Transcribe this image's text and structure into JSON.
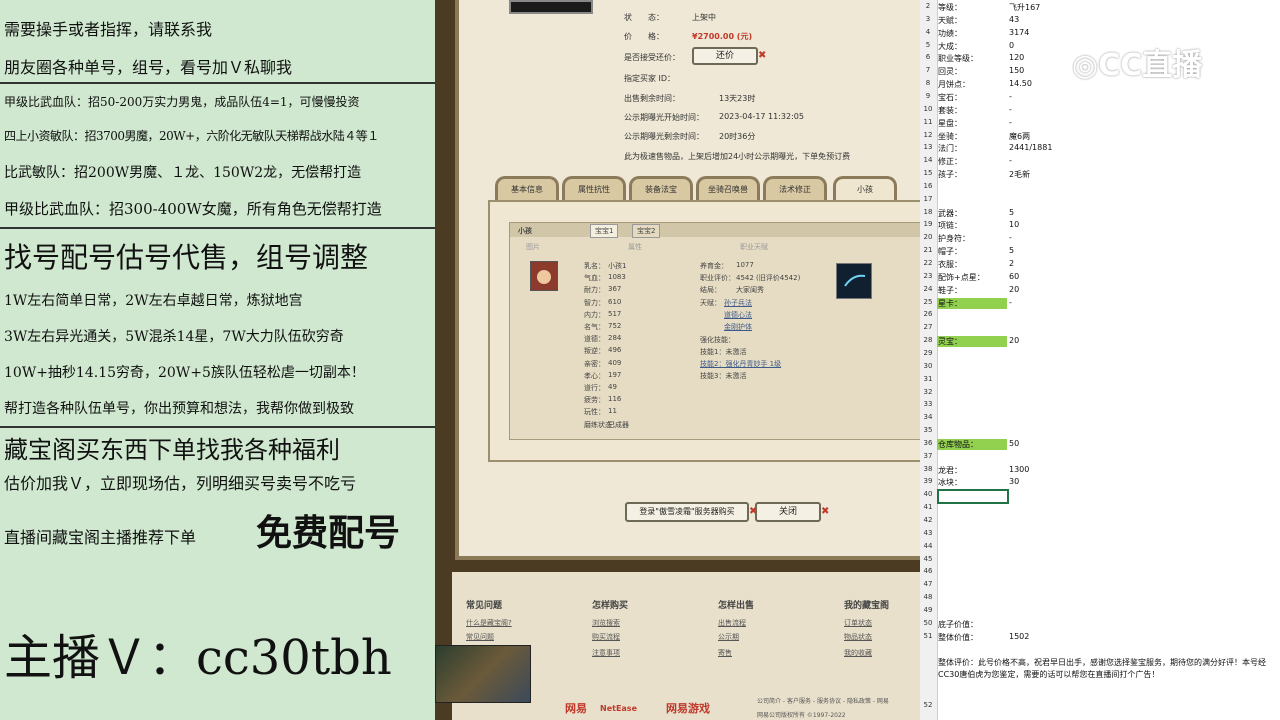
{
  "left_overlay": {
    "lines": [
      "需要操手或者指挥，请联系我",
      "朋友圈各种单号，组号，看号加Ｖ私聊我",
      "甲级比武血队：招50-200万实力男鬼，成品队伍4=1，可慢慢投资",
      "四上小资敏队：招3700男魔，20W+，六阶化无敏队天梯帮战水陆４等１",
      "比武敏队：招200W男魔、１龙、150W2龙，无偿帮打造",
      "甲级比武血队：招300-400W女魔，所有角色无偿帮打造",
      "找号配号估号代售，组号调整",
      "1W左右简单日常，2W左右卓越日常，炼狱地宫",
      "3W左右异光通关，5W混杀14星，7W大力队伍砍穷奇",
      "10W+抽秒14.15穷奇，20W+5族队伍轻松虐一切副本！",
      "帮打造各种队伍单号，你出预算和想法，我帮你做到极致",
      "藏宝阁买东西下单找我各种福利",
      "估价加我Ｖ，立即现场估，列明细买号卖号不吃亏",
      "直播间藏宝阁主播推荐下单",
      "免费配号",
      "主播Ｖ：cc30tbh"
    ]
  },
  "listing": {
    "status_label": "状　　态：",
    "status_value": "上架中",
    "price_label": "价　　格：",
    "price_value": "¥2700.00 (元)",
    "bargain_label": "是否接受还价：",
    "bargain_button": "还价",
    "buyer_id_label": "指定买家 ID：",
    "remaining_label": "出售剩余时间：",
    "remaining_value": "13天23时",
    "public_start_label": "公示期曝光开始时间：",
    "public_start_value": "2023-04-17 11:32:05",
    "public_remaining_label": "公示期曝光剩余时间：",
    "public_remaining_value": "20时36分",
    "notice": "此为极速售物品，上架后增加24小时公示期曝光，下单免预订费"
  },
  "tabs": [
    "基本信息",
    "属性抗性",
    "装备法宝",
    "坐骑召唤兽",
    "法术修正",
    "小孩"
  ],
  "child_panel": {
    "title": "小孩",
    "subtabs": [
      "宝宝1",
      "宝宝2"
    ],
    "col_headers": [
      "图片",
      "属性",
      "职业天赋"
    ],
    "stats": [
      {
        "k": "乳名：",
        "v": "小孩1"
      },
      {
        "k": "气血：",
        "v": "1083"
      },
      {
        "k": "耐力：",
        "v": "367"
      },
      {
        "k": "智力：",
        "v": "610"
      },
      {
        "k": "内力：",
        "v": "517"
      },
      {
        "k": "名气：",
        "v": "752"
      },
      {
        "k": "道德：",
        "v": "284"
      },
      {
        "k": "叛逆：",
        "v": "496"
      },
      {
        "k": "亲密：",
        "v": "409"
      },
      {
        "k": "孝心：",
        "v": "197"
      },
      {
        "k": "道行：",
        "v": "49"
      },
      {
        "k": "疲劳：",
        "v": "116"
      },
      {
        "k": "玩性：",
        "v": "11"
      },
      {
        "k": "磨练状态：",
        "v": "已成器"
      }
    ],
    "career": [
      {
        "k": "养育金：",
        "v": "1077"
      },
      {
        "k": "职业评价：",
        "v": "4542 (旧评价4542)"
      },
      {
        "k": "结局：",
        "v": "大家闺秀"
      },
      {
        "k": "天赋：",
        "v": "孙子兵法"
      }
    ],
    "talent_links": [
      "孙子兵法",
      "道德心法",
      "金刚护体"
    ],
    "skills_label": "强化技能：",
    "skills": [
      "技能1：未激活",
      "技能2：强化丹青妙手 1级",
      "技能3：未激活"
    ]
  },
  "actions": {
    "login_buy": "登录\"傲雪凌霜\"服务器购买",
    "close": "关闭"
  },
  "footer": {
    "cols": [
      {
        "head": "常见问题",
        "links": [
          "什么是藏宝阁?",
          "常见问题"
        ]
      },
      {
        "head": "怎样购买",
        "links": [
          "浏览搜索",
          "购买流程",
          "注意事项"
        ]
      },
      {
        "head": "怎样出售",
        "links": [
          "出售流程",
          "公示期",
          "寄售"
        ]
      },
      {
        "head": "我的藏宝阁",
        "links": [
          "订单状态",
          "物品状态",
          "我的收藏"
        ]
      }
    ],
    "brand_wy": "网易",
    "brand_netease": "NetEase",
    "brand_games": "网易游戏",
    "bottom_links": "公司简介 - 客户服务 - 服务协议 - 隐私政策 - 网易",
    "copyright": "网易公司版权所有 ©1997-2022"
  },
  "sheet": {
    "rows": [
      {
        "n": "2",
        "a": "等级：",
        "b": "飞升167"
      },
      {
        "n": "3",
        "a": "天赋：",
        "b": "43"
      },
      {
        "n": "4",
        "a": "功绩：",
        "b": "3174"
      },
      {
        "n": "5",
        "a": "大成：",
        "b": "0"
      },
      {
        "n": "6",
        "a": "职业等级：",
        "b": "120"
      },
      {
        "n": "7",
        "a": "回灵：",
        "b": "150"
      },
      {
        "n": "8",
        "a": "月饼点：",
        "b": "14.50"
      },
      {
        "n": "9",
        "a": "宝石：",
        "b": "-"
      },
      {
        "n": "10",
        "a": "套装：",
        "b": "-"
      },
      {
        "n": "11",
        "a": "星盘：",
        "b": "-"
      },
      {
        "n": "12",
        "a": "坐骑：",
        "b": "魔6两"
      },
      {
        "n": "13",
        "a": "法门：",
        "b": "2441/1881"
      },
      {
        "n": "14",
        "a": "修正：",
        "b": "-"
      },
      {
        "n": "15",
        "a": "孩子：",
        "b": "2毛新"
      },
      {
        "n": "16",
        "a": "",
        "b": ""
      },
      {
        "n": "17",
        "a": "",
        "b": ""
      },
      {
        "n": "18",
        "a": "武器：",
        "b": "5"
      },
      {
        "n": "19",
        "a": "项链：",
        "b": "10"
      },
      {
        "n": "20",
        "a": "护身符：",
        "b": "-"
      },
      {
        "n": "21",
        "a": "帽子：",
        "b": "5"
      },
      {
        "n": "22",
        "a": "衣服：",
        "b": "2"
      },
      {
        "n": "23",
        "a": "配饰+点星：",
        "b": "60"
      },
      {
        "n": "24",
        "a": "鞋子：",
        "b": "20"
      },
      {
        "n": "25",
        "a": "星卡：",
        "b": "-",
        "hl": true
      },
      {
        "n": "26",
        "a": "",
        "b": ""
      },
      {
        "n": "27",
        "a": "",
        "b": ""
      },
      {
        "n": "28",
        "a": "灵宝：",
        "b": "20",
        "hl": true
      },
      {
        "n": "29",
        "a": "",
        "b": ""
      },
      {
        "n": "30",
        "a": "",
        "b": ""
      },
      {
        "n": "31",
        "a": "",
        "b": ""
      },
      {
        "n": "32",
        "a": "",
        "b": ""
      },
      {
        "n": "33",
        "a": "",
        "b": ""
      },
      {
        "n": "34",
        "a": "",
        "b": ""
      },
      {
        "n": "35",
        "a": "",
        "b": ""
      },
      {
        "n": "36",
        "a": "仓库物品：",
        "b": "50",
        "hl": true
      },
      {
        "n": "37",
        "a": "",
        "b": ""
      },
      {
        "n": "38",
        "a": "龙君：",
        "b": "1300"
      },
      {
        "n": "39",
        "a": "冰块：",
        "b": "30"
      },
      {
        "n": "40",
        "a": "",
        "b": "",
        "sel": true
      },
      {
        "n": "41",
        "a": "",
        "b": ""
      },
      {
        "n": "42",
        "a": "",
        "b": ""
      },
      {
        "n": "43",
        "a": "",
        "b": ""
      },
      {
        "n": "44",
        "a": "",
        "b": ""
      },
      {
        "n": "45",
        "a": "",
        "b": ""
      },
      {
        "n": "46",
        "a": "",
        "b": ""
      },
      {
        "n": "47",
        "a": "",
        "b": ""
      },
      {
        "n": "48",
        "a": "",
        "b": ""
      },
      {
        "n": "49",
        "a": "",
        "b": ""
      },
      {
        "n": "50",
        "a": "底子价值：",
        "b": ""
      },
      {
        "n": "51",
        "a": "整体价值：",
        "b": "1502"
      }
    ],
    "evaluation": "整体评价：此号价格不高，祝君早日出手，感谢您选择鉴宝服务，期待您的满分好评！本号经CC30唐伯虎为您鉴定，需要的话可以帮您在直播间打个广告！",
    "last_row_num": "52",
    "watermark": "CC直播",
    "colors": {
      "highlight": "#92d050",
      "selection": "#217346"
    }
  }
}
